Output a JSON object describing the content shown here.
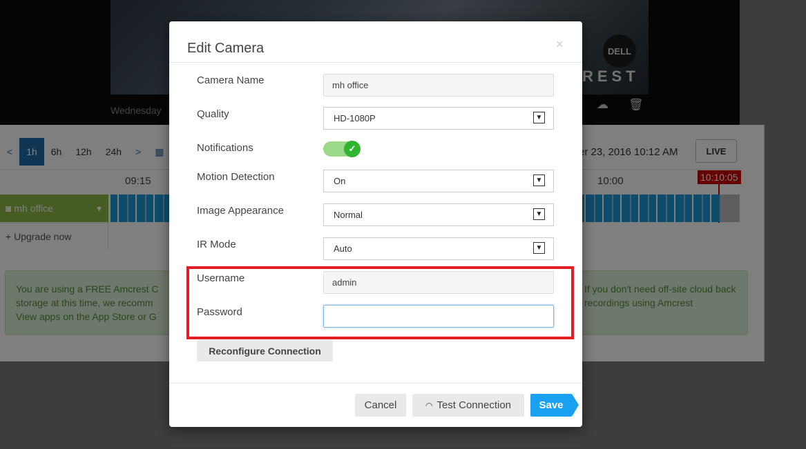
{
  "background": {
    "video": {
      "date_prefix": "Wednesday",
      "brand": "REST",
      "logo": "DELL",
      "icons": [
        "cloud-download-icon",
        "trash-icon"
      ]
    },
    "range_selector": {
      "prev": "<",
      "options": [
        "1h",
        "6h",
        "12h",
        "24h"
      ],
      "active": "1h",
      "next": ">",
      "calendar_icon": "calendar-icon"
    },
    "date_text": "er 23, 2016 10:12 AM",
    "live_label": "LIVE",
    "timeline": {
      "ticks": [
        "09:15",
        "10:00"
      ],
      "current_time": "10:10:05"
    },
    "camera_row": {
      "name": "mh office",
      "icon": "camera-icon",
      "dropdown_icon": "caret-down-icon"
    },
    "upgrade_label": "Upgrade now",
    "notice": {
      "left": "You are using a FREE Amcrest C storage at this time, we recomm View apps on the App Store or G",
      "right": "If you don't need off-site cloud back recordings using Amcrest"
    }
  },
  "modal": {
    "title": "Edit Camera",
    "close_icon": "×",
    "fields": {
      "camera_name": {
        "label": "Camera Name",
        "value": "mh office"
      },
      "quality": {
        "label": "Quality",
        "value": "HD-1080P"
      },
      "notifications": {
        "label": "Notifications",
        "enabled": true
      },
      "motion_detection": {
        "label": "Motion Detection",
        "value": "On"
      },
      "image_appearance": {
        "label": "Image Appearance",
        "value": "Normal"
      },
      "ir_mode": {
        "label": "IR Mode",
        "value": "Auto"
      },
      "username": {
        "label": "Username",
        "value": "admin"
      },
      "password": {
        "label": "Password",
        "value": ""
      }
    },
    "reconfigure_label": "Reconfigure Connection",
    "buttons": {
      "cancel": "Cancel",
      "test_connection": "Test Connection",
      "save": "Save"
    },
    "highlight_color": "#e01e26",
    "accent_color": "#1ba1f2"
  }
}
